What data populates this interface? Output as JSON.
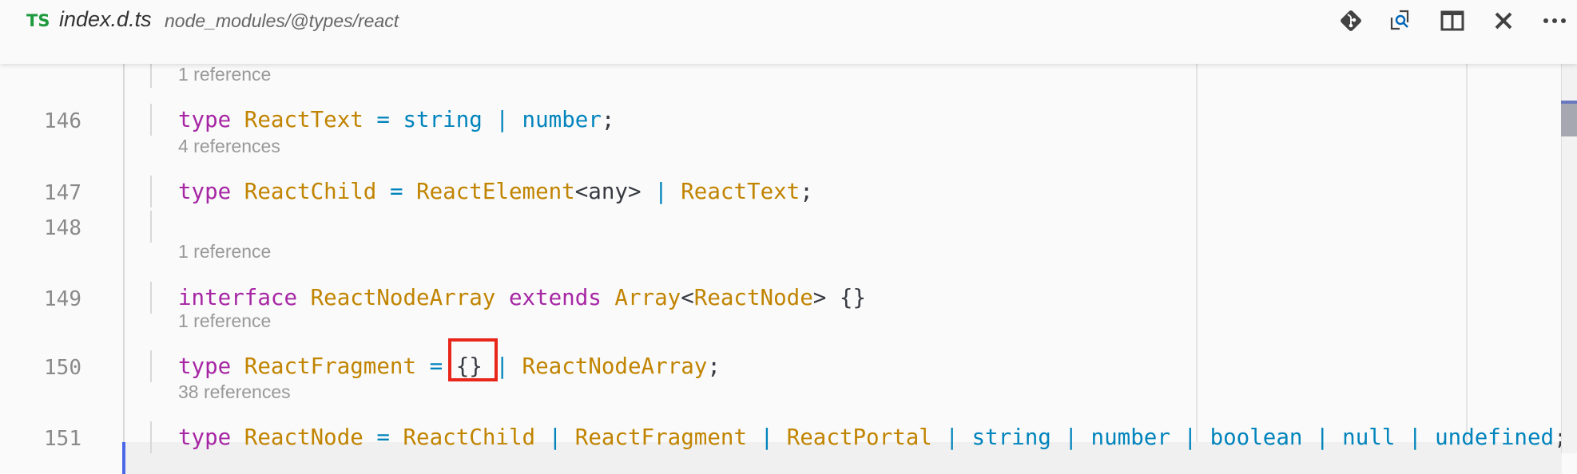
{
  "tab": {
    "lang_badge": "TS",
    "filename": "index.d.ts",
    "path": "node_modules/@types/react"
  },
  "toolbar": {
    "icons": [
      "git-icon",
      "open-changes-search-icon",
      "split-editor-icon",
      "close-icon",
      "more-icon"
    ]
  },
  "colors": {
    "keyword": "#a626a4",
    "type": "#c18401",
    "operator": "#0184bc",
    "builtin": "#0184bc",
    "highlight_box": "#e8261a",
    "ts_badge": "#1d9a3e"
  },
  "lines": [
    {
      "ref": "1 reference",
      "num": "146",
      "tokens": [
        [
          "k",
          "type"
        ],
        [
          "p",
          " "
        ],
        [
          "t",
          "ReactText"
        ],
        [
          "p",
          " "
        ],
        [
          "o",
          "="
        ],
        [
          "p",
          " "
        ],
        [
          "b",
          "string"
        ],
        [
          "p",
          " "
        ],
        [
          "o",
          "|"
        ],
        [
          "p",
          " "
        ],
        [
          "b",
          "number"
        ],
        [
          "p",
          ";"
        ]
      ]
    },
    {
      "ref": "4 references",
      "num": "147",
      "tokens": [
        [
          "k",
          "type"
        ],
        [
          "p",
          " "
        ],
        [
          "t",
          "ReactChild"
        ],
        [
          "p",
          " "
        ],
        [
          "o",
          "="
        ],
        [
          "p",
          " "
        ],
        [
          "t",
          "ReactElement"
        ],
        [
          "p",
          "<any>"
        ],
        [
          "p",
          " "
        ],
        [
          "o",
          "|"
        ],
        [
          "p",
          " "
        ],
        [
          "t",
          "ReactText"
        ],
        [
          "p",
          ";"
        ]
      ]
    },
    {
      "ref": "",
      "num": "148",
      "tokens": []
    },
    {
      "ref": "1 reference",
      "num": "149",
      "tokens": [
        [
          "k",
          "interface"
        ],
        [
          "p",
          " "
        ],
        [
          "t",
          "ReactNodeArray"
        ],
        [
          "p",
          " "
        ],
        [
          "k",
          "extends"
        ],
        [
          "p",
          " "
        ],
        [
          "t",
          "Array"
        ],
        [
          "p",
          "<"
        ],
        [
          "t",
          "ReactNode"
        ],
        [
          "p",
          "> {}"
        ]
      ]
    },
    {
      "ref": "1 reference",
      "num": "150",
      "tokens": [
        [
          "k",
          "type"
        ],
        [
          "p",
          " "
        ],
        [
          "t",
          "ReactFragment"
        ],
        [
          "p",
          " "
        ],
        [
          "o",
          "="
        ],
        [
          "p",
          " "
        ],
        [
          "p",
          "{}"
        ],
        [
          "p",
          " "
        ],
        [
          "o",
          "|"
        ],
        [
          "p",
          " "
        ],
        [
          "t",
          "ReactNodeArray"
        ],
        [
          "p",
          ";"
        ]
      ]
    },
    {
      "ref": "38 references",
      "num": "151",
      "tokens": [
        [
          "k",
          "type"
        ],
        [
          "p",
          " "
        ],
        [
          "t",
          "ReactNode"
        ],
        [
          "p",
          " "
        ],
        [
          "o",
          "="
        ],
        [
          "p",
          " "
        ],
        [
          "t",
          "ReactChild"
        ],
        [
          "p",
          " "
        ],
        [
          "o",
          "|"
        ],
        [
          "p",
          " "
        ],
        [
          "t",
          "ReactFragment"
        ],
        [
          "p",
          " "
        ],
        [
          "o",
          "|"
        ],
        [
          "p",
          " "
        ],
        [
          "t",
          "ReactPortal"
        ],
        [
          "p",
          " "
        ],
        [
          "o",
          "|"
        ],
        [
          "p",
          " "
        ],
        [
          "b",
          "string"
        ],
        [
          "p",
          " "
        ],
        [
          "o",
          "|"
        ],
        [
          "p",
          " "
        ],
        [
          "b",
          "number"
        ],
        [
          "p",
          " "
        ],
        [
          "o",
          "|"
        ],
        [
          "p",
          " "
        ],
        [
          "b",
          "boolean"
        ],
        [
          "p",
          " "
        ],
        [
          "o",
          "|"
        ],
        [
          "p",
          " "
        ],
        [
          "b",
          "null"
        ],
        [
          "p",
          " "
        ],
        [
          "o",
          "|"
        ],
        [
          "p",
          " "
        ],
        [
          "b",
          "undefined"
        ],
        [
          "p",
          ";"
        ]
      ]
    }
  ]
}
